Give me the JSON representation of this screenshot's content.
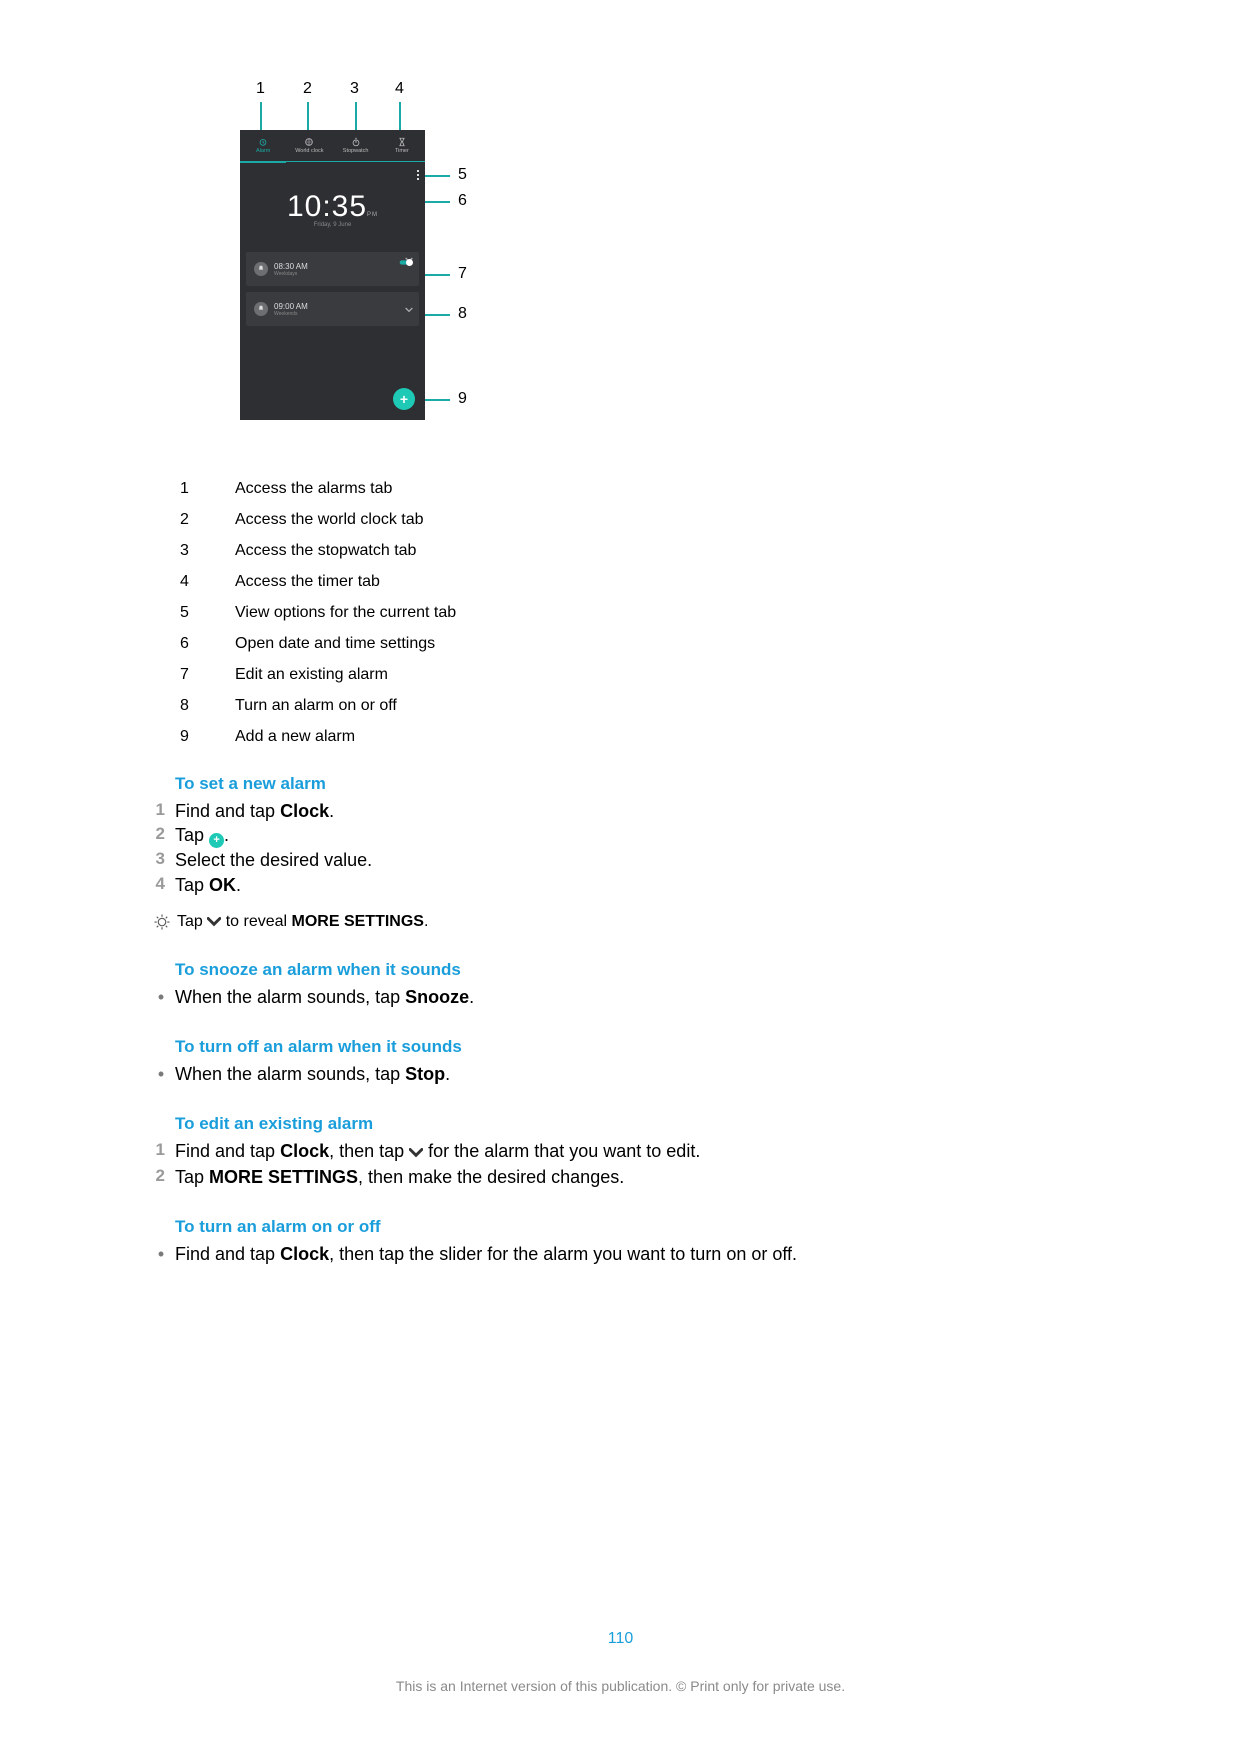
{
  "screenshot": {
    "tabs": [
      {
        "label": "Alarm",
        "icon": "alarm-icon",
        "active": true
      },
      {
        "label": "World clock",
        "icon": "world-clock-icon",
        "active": false
      },
      {
        "label": "Stopwatch",
        "icon": "stopwatch-icon",
        "active": false
      },
      {
        "label": "Timer",
        "icon": "timer-icon",
        "active": false
      }
    ],
    "time": "10:35",
    "ampm": "PM",
    "date": "Friday, 9 June",
    "alarms": [
      {
        "time": "08:30 AM",
        "label": "Weekdays",
        "on": true
      },
      {
        "time": "09:00 AM",
        "label": "Weekends",
        "on": false
      }
    ],
    "fab": "+"
  },
  "callouts": [
    {
      "n": "1",
      "desc": "Access the alarms tab"
    },
    {
      "n": "2",
      "desc": "Access the world clock tab"
    },
    {
      "n": "3",
      "desc": "Access the stopwatch tab"
    },
    {
      "n": "4",
      "desc": "Access the timer tab"
    },
    {
      "n": "5",
      "desc": "View options for the current tab"
    },
    {
      "n": "6",
      "desc": "Open date and time settings"
    },
    {
      "n": "7",
      "desc": "Edit an existing alarm"
    },
    {
      "n": "8",
      "desc": "Turn an alarm on or off"
    },
    {
      "n": "9",
      "desc": "Add a new alarm"
    }
  ],
  "sections": {
    "set_new": {
      "title": "To set a new alarm",
      "steps": [
        {
          "n": "1",
          "pre": "Find and tap ",
          "bold": "Clock",
          "post": "."
        },
        {
          "n": "2",
          "pre": "Tap ",
          "icon": "plus",
          "post": "."
        },
        {
          "n": "3",
          "pre": "Select the desired value.",
          "bold": "",
          "post": ""
        },
        {
          "n": "4",
          "pre": "Tap ",
          "bold": "OK",
          "post": "."
        }
      ],
      "tip_pre": "Tap ",
      "tip_mid": " to reveal ",
      "tip_bold": "MORE SETTINGS",
      "tip_post": "."
    },
    "snooze": {
      "title": "To snooze an alarm when it sounds",
      "line_pre": "When the alarm sounds, tap ",
      "line_bold": "Snooze",
      "line_post": "."
    },
    "turnoff_sound": {
      "title": "To turn off an alarm when it sounds",
      "line_pre": "When the alarm sounds, tap ",
      "line_bold": "Stop",
      "line_post": "."
    },
    "edit": {
      "title": "To edit an existing alarm",
      "step1_pre": "Find and tap ",
      "step1_bold": "Clock",
      "step1_mid": ", then tap ",
      "step1_post": " for the alarm that you want to edit.",
      "step2_pre": "Tap ",
      "step2_bold": "MORE SETTINGS",
      "step2_post": ", then make the desired changes."
    },
    "onoff": {
      "title": "To turn an alarm on or off",
      "line_pre": "Find and tap ",
      "line_bold": "Clock",
      "line_post": ", then tap the slider for the alarm you want to turn on or off."
    }
  },
  "page_number": "110",
  "footer": "This is an Internet version of this publication. © Print only for private use."
}
